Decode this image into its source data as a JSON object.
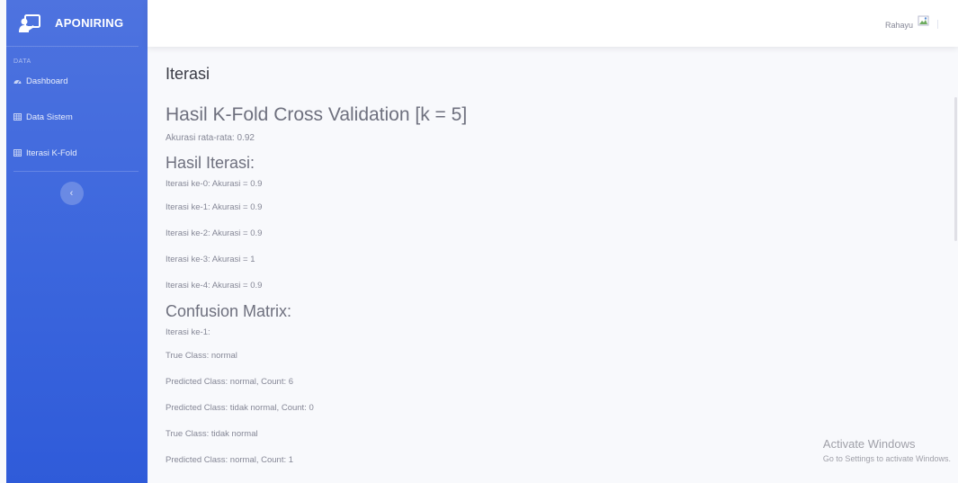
{
  "sidebar": {
    "brand": "APONIRING",
    "heading": "DATA",
    "items": [
      {
        "label": "Dashboard",
        "icon": "dashboard-icon"
      },
      {
        "label": "Data Sistem",
        "icon": "table-icon"
      },
      {
        "label": "Iterasi K-Fold",
        "icon": "table-icon"
      }
    ],
    "toggle_icon": "chevron-left-icon"
  },
  "topbar": {
    "user_name": "Rahayu"
  },
  "content": {
    "page_title": "Iterasi",
    "main_heading": "Hasil K-Fold Cross Validation [k = 5]",
    "average_accuracy": "Akurasi rata-rata: 0.92",
    "iterations_heading": "Hasil Iterasi:",
    "iterations": [
      "Iterasi ke-0: Akurasi = 0.9",
      "Iterasi ke-1: Akurasi = 0.9",
      "Iterasi ke-2: Akurasi = 0.9",
      "Iterasi ke-3: Akurasi = 1",
      "Iterasi ke-4: Akurasi = 0.9"
    ],
    "confusion_heading": "Confusion Matrix:",
    "confusion_lines": [
      "Iterasi ke-1:",
      "True Class: normal",
      "Predicted Class: normal, Count: 6",
      "Predicted Class: tidak normal, Count: 0",
      "True Class: tidak normal",
      "Predicted Class: normal, Count: 1"
    ]
  },
  "watermark": {
    "title": "Activate Windows",
    "subtitle": "Go to Settings to activate Windows."
  },
  "colors": {
    "sidebar": "#4e73df",
    "background": "#f8f9fc",
    "text": "#858796"
  }
}
